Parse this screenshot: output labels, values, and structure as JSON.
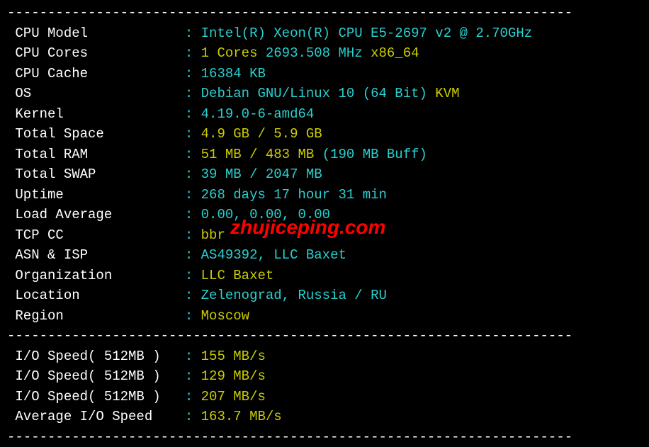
{
  "divider": "----------------------------------------------------------------------",
  "rows": [
    {
      "label": "CPU Model            ",
      "colon": ":",
      "parts": [
        {
          "text": " Intel(R) Xeon(R) CPU E5-2697 v2 @ 2.70GHz",
          "cls": "cyan"
        }
      ]
    },
    {
      "label": "CPU Cores            ",
      "colon": ":",
      "parts": [
        {
          "text": " 1 Cores",
          "cls": "yellow"
        },
        {
          "text": " 2693.508 MHz",
          "cls": "cyan"
        },
        {
          "text": " x86_64",
          "cls": "yellow"
        }
      ]
    },
    {
      "label": "CPU Cache            ",
      "colon": ":",
      "parts": [
        {
          "text": " 16384 KB",
          "cls": "cyan"
        }
      ]
    },
    {
      "label": "OS                   ",
      "colon": ":",
      "parts": [
        {
          "text": " Debian GNU/Linux 10 (64 Bit)",
          "cls": "cyan"
        },
        {
          "text": " KVM",
          "cls": "yellow"
        }
      ]
    },
    {
      "label": "Kernel               ",
      "colon": ":",
      "parts": [
        {
          "text": " 4.19.0-6-amd64",
          "cls": "cyan"
        }
      ]
    },
    {
      "label": "Total Space          ",
      "colon": ":",
      "parts": [
        {
          "text": " 4.9 GB / 5.9 GB",
          "cls": "yellow"
        }
      ]
    },
    {
      "label": "Total RAM            ",
      "colon": ":",
      "parts": [
        {
          "text": " 51 MB / 483 MB",
          "cls": "yellow"
        },
        {
          "text": " (190 MB Buff)",
          "cls": "cyan"
        }
      ]
    },
    {
      "label": "Total SWAP           ",
      "colon": ":",
      "parts": [
        {
          "text": " 39 MB / 2047 MB",
          "cls": "cyan"
        }
      ]
    },
    {
      "label": "Uptime               ",
      "colon": ":",
      "parts": [
        {
          "text": " 268 days 17 hour 31 min",
          "cls": "cyan"
        }
      ]
    },
    {
      "label": "Load Average         ",
      "colon": ":",
      "parts": [
        {
          "text": " 0.00, 0.00, 0.00",
          "cls": "cyan"
        }
      ]
    },
    {
      "label": "TCP CC               ",
      "colon": ":",
      "parts": [
        {
          "text": " bbr",
          "cls": "yellow"
        }
      ]
    },
    {
      "label": "ASN & ISP            ",
      "colon": ":",
      "parts": [
        {
          "text": " AS49392, LLC Baxet",
          "cls": "cyan"
        }
      ]
    },
    {
      "label": "Organization         ",
      "colon": ":",
      "parts": [
        {
          "text": " LLC Baxet",
          "cls": "yellow"
        }
      ]
    },
    {
      "label": "Location             ",
      "colon": ":",
      "parts": [
        {
          "text": " Zelenograd, Russia / RU",
          "cls": "cyan"
        }
      ]
    },
    {
      "label": "Region               ",
      "colon": ":",
      "parts": [
        {
          "text": " Moscow",
          "cls": "yellow"
        }
      ]
    }
  ],
  "io_rows": [
    {
      "label": "I/O Speed( 512MB )   ",
      "colon": ":",
      "parts": [
        {
          "text": " 155 MB/s",
          "cls": "yellow"
        }
      ]
    },
    {
      "label": "I/O Speed( 512MB )   ",
      "colon": ":",
      "parts": [
        {
          "text": " 129 MB/s",
          "cls": "yellow"
        }
      ]
    },
    {
      "label": "I/O Speed( 512MB )   ",
      "colon": ":",
      "parts": [
        {
          "text": " 207 MB/s",
          "cls": "yellow"
        }
      ]
    },
    {
      "label": "Average I/O Speed    ",
      "colon": ":",
      "parts": [
        {
          "text": " 163.7 MB/s",
          "cls": "yellow"
        }
      ]
    }
  ],
  "watermark": "zhujiceping.com"
}
